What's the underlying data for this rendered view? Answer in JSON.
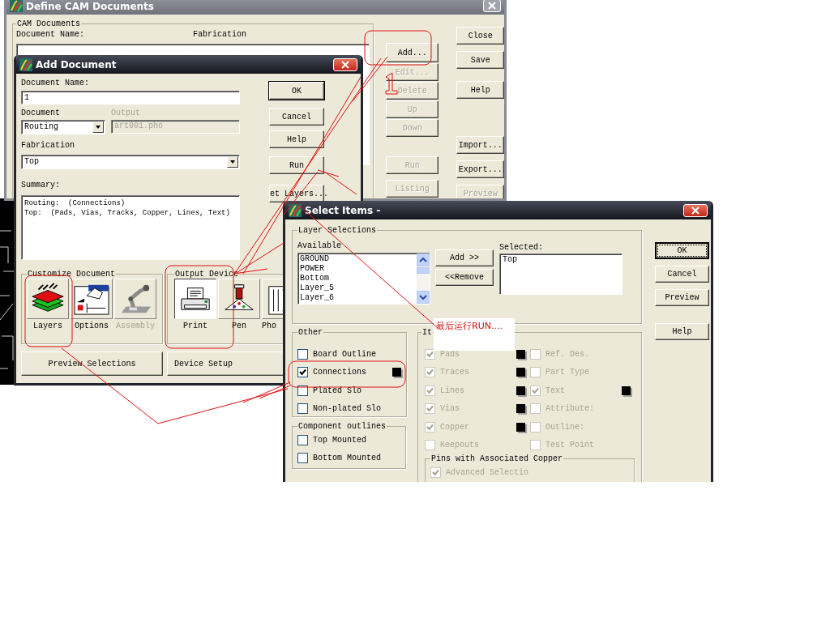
{
  "define_window": {
    "title": "Define CAM Documents",
    "group_label": "CAM Documents",
    "columns": [
      "Document Name:",
      "Fabrication"
    ],
    "list_buttons": [
      {
        "label": "Add...",
        "disabled": false
      },
      {
        "label": "Edit...",
        "disabled": true
      },
      {
        "label": "Delete",
        "disabled": true
      },
      {
        "label": "Up",
        "disabled": true
      },
      {
        "label": "Down",
        "disabled": true
      },
      {
        "label": "Run",
        "disabled": true
      },
      {
        "label": "Listing",
        "disabled": true
      }
    ],
    "side_buttons": [
      {
        "label": "Close",
        "disabled": false
      },
      {
        "label": "Save",
        "disabled": false
      },
      {
        "label": "Help",
        "disabled": false
      },
      {
        "label": "Import...",
        "disabled": false
      },
      {
        "label": "Export...",
        "disabled": false
      },
      {
        "label": "Preview",
        "disabled": true
      }
    ]
  },
  "add_window": {
    "title": "Add Document",
    "name_label": "Document Name:",
    "name_value": "1",
    "document_label": "Document",
    "document_value": "Routing",
    "output_label": "Output",
    "output_value": "art001.pho",
    "fabrication_label": "Fabrication",
    "fabrication_value": "Top",
    "summary_label": "Summary:",
    "summary_lines": [
      "Routing:  (Connections)",
      "Top:  (Pads, Vias, Tracks, Copper, Lines, Text)"
    ],
    "buttons": [
      {
        "label": "OK",
        "default": true
      },
      {
        "label": "Cancel",
        "default": false
      },
      {
        "label": "Help",
        "default": false
      },
      {
        "label": "Run",
        "default": false
      },
      {
        "label": "et Layers...",
        "default": false
      }
    ],
    "customize_label": "Customize Document",
    "customize_items": [
      {
        "kind": "layers",
        "label": "Layers",
        "selected": false,
        "disabled": false
      },
      {
        "kind": "options",
        "label": "Options",
        "selected": false,
        "disabled": false
      },
      {
        "kind": "assembly",
        "label": "Assembly",
        "selected": false,
        "disabled": true
      }
    ],
    "output_device_label": "Output Device",
    "output_items": [
      {
        "kind": "print",
        "label": "Print",
        "selected": true,
        "disabled": false
      },
      {
        "kind": "pen",
        "label": "Pen",
        "selected": false,
        "disabled": false
      },
      {
        "kind": "photo",
        "label": "Pho",
        "selected": false,
        "disabled": false
      }
    ],
    "bottom_buttons": [
      "Preview Selections",
      "Device Setup"
    ]
  },
  "select_window": {
    "title": "Select Items -",
    "layer_group": "Layer Selections",
    "available_label": "Available",
    "available": [
      "GROUND",
      "POWER",
      "Bottom",
      "Layer_5",
      "Layer_6"
    ],
    "add_button": "Add >>",
    "remove_button": "<<Remove",
    "selected_label": "Selected:",
    "selected": [
      "Top"
    ],
    "buttons": [
      {
        "label": "OK",
        "default": true
      },
      {
        "label": "Cancel",
        "default": false
      },
      {
        "label": "Preview",
        "default": false
      },
      {
        "label": "Help",
        "default": false
      }
    ],
    "other_group": "Other",
    "other_items": [
      {
        "label": "Board Outline",
        "checked": false
      },
      {
        "label": "Connections",
        "checked": true
      },
      {
        "label": "Plated Slo",
        "checked": false
      },
      {
        "label": "Non-plated Slo",
        "checked": false
      }
    ],
    "component_group": "Component outlines",
    "component_items": [
      {
        "label": "Top Mounted",
        "checked": false
      },
      {
        "label": "Bottom Mounted",
        "checked": false
      }
    ],
    "items_group": "It",
    "items_left": [
      {
        "label": "Pads",
        "checked": true,
        "disabled": true
      },
      {
        "label": "Traces",
        "checked": true,
        "disabled": true
      },
      {
        "label": "Lines",
        "checked": true,
        "disabled": true
      },
      {
        "label": "Vias",
        "checked": true,
        "disabled": true
      },
      {
        "label": "Copper",
        "checked": true,
        "disabled": true
      },
      {
        "label": "Keepouts",
        "checked": false,
        "disabled": true
      }
    ],
    "items_right": [
      {
        "label": "Ref. Des.",
        "checked": false,
        "disabled": true
      },
      {
        "label": "Part Type",
        "checked": false,
        "disabled": true
      },
      {
        "label": "Text",
        "checked": true,
        "disabled": true
      },
      {
        "label": "Attribute:",
        "checked": false,
        "disabled": true
      },
      {
        "label": "Outline:",
        "checked": false,
        "disabled": true
      },
      {
        "label": "Test Point",
        "checked": false,
        "disabled": true
      }
    ],
    "pins_group": "Pins with Associated Copper",
    "pins_items": [
      {
        "label": "Advanced Selectio",
        "checked": true,
        "disabled": true
      }
    ]
  },
  "annotation": {
    "note": "最后运行RUN...."
  }
}
